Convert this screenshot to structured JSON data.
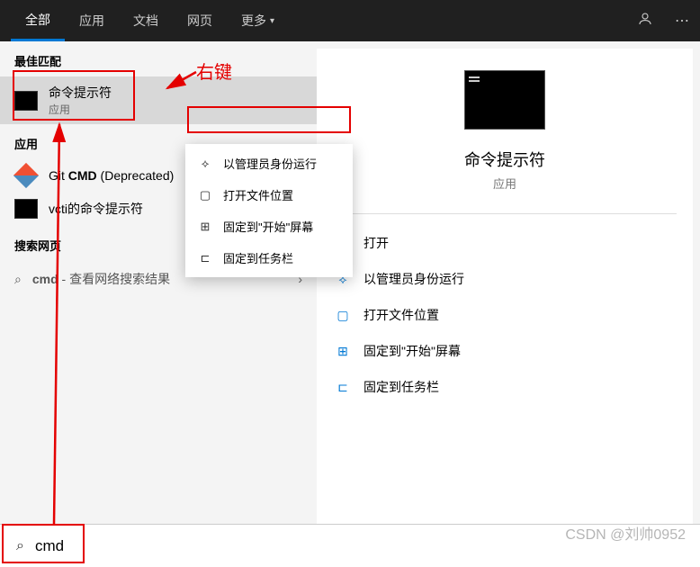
{
  "header": {
    "tabs": [
      "全部",
      "应用",
      "文档",
      "网页",
      "更多"
    ],
    "active_tab": 0
  },
  "sections": {
    "best_match": "最佳匹配",
    "apps": "应用",
    "search_web": "搜索网页"
  },
  "best_match_item": {
    "title_prefix": "",
    "title_bold": "",
    "title": "命令提示符",
    "subtitle": "应用"
  },
  "app_results": [
    {
      "title_pre": "Git ",
      "title_bold": "CMD",
      "title_post": " (Deprecated)",
      "icon": "git"
    },
    {
      "title_pre": "vcti",
      "title_bold": "",
      "title_post": "的命令提示符",
      "icon": "cmd"
    }
  ],
  "web_result": {
    "query_bold": "cmd",
    "suffix": " - 查看网络搜索结果"
  },
  "context_menu": [
    {
      "icon": "⟡",
      "label": "以管理员身份运行"
    },
    {
      "icon": "▢",
      "label": "打开文件位置"
    },
    {
      "icon": "⊞",
      "label": "固定到\"开始\"屏幕"
    },
    {
      "icon": "⊏",
      "label": "固定到任务栏"
    }
  ],
  "preview": {
    "title": "命令提示符",
    "subtitle": "应用",
    "actions": [
      {
        "icon": "▭",
        "label": "打开"
      },
      {
        "icon": "⟡",
        "label": "以管理员身份运行"
      },
      {
        "icon": "▢",
        "label": "打开文件位置"
      },
      {
        "icon": "⊞",
        "label": "固定到\"开始\"屏幕"
      },
      {
        "icon": "⊏",
        "label": "固定到任务栏"
      }
    ]
  },
  "search": {
    "value": "cmd"
  },
  "annotations": {
    "right_click": "右键"
  },
  "watermark": "CSDN @刘帅0952"
}
